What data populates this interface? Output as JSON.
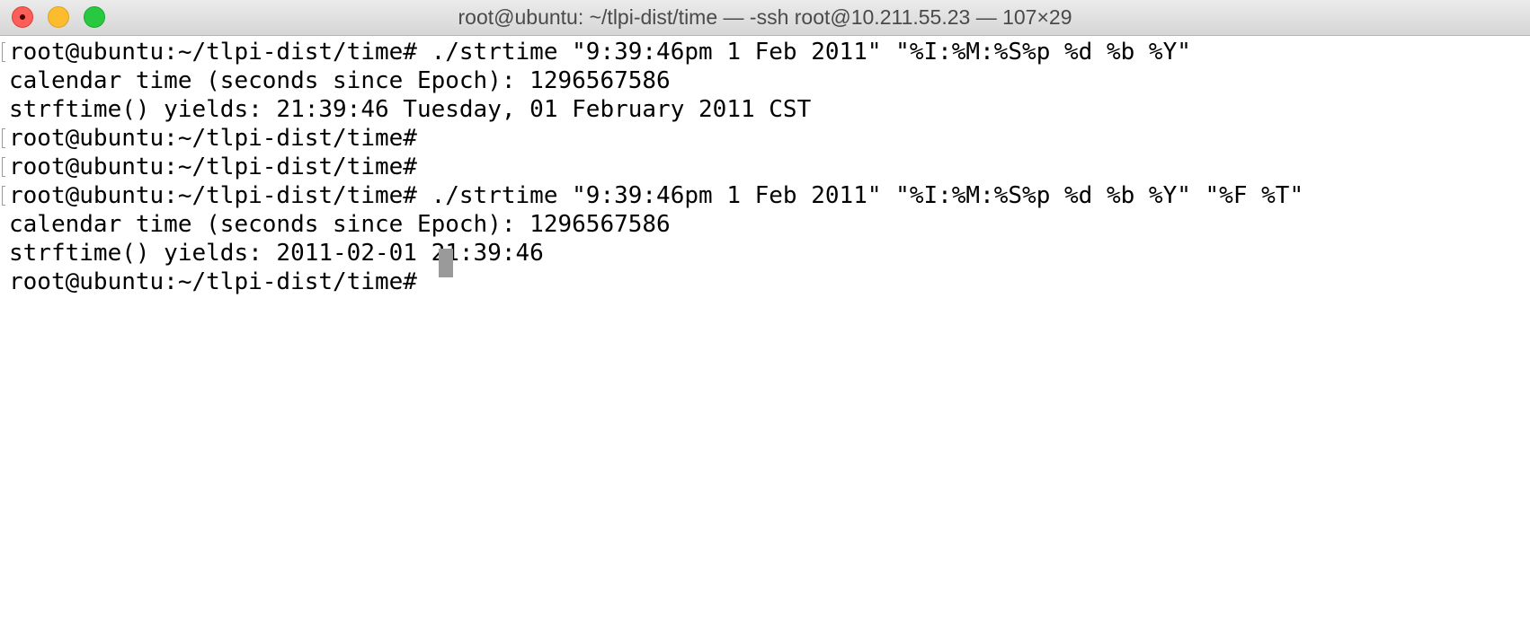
{
  "window": {
    "title": "root@ubuntu: ~/tlpi-dist/time — -ssh root@10.211.55.23 — 107×29",
    "controls": [
      "close-icon",
      "minimize-icon",
      "zoom-icon"
    ],
    "colors": {
      "close": "#fc5f57",
      "minimize": "#fdbc2e",
      "zoom": "#28c840",
      "background": "#ffffff",
      "text": "#000000",
      "cursor": "#9a9a9a"
    }
  },
  "terminal": {
    "lines": [
      "root@ubuntu:~/tlpi-dist/time# ./strtime \"9:39:46pm 1 Feb 2011\" \"%I:%M:%S%p %d %b %Y\"",
      "calendar time (seconds since Epoch): 1296567586",
      "strftime() yields: 21:39:46 Tuesday, 01 February 2011 CST",
      "root@ubuntu:~/tlpi-dist/time#",
      "root@ubuntu:~/tlpi-dist/time#",
      "root@ubuntu:~/tlpi-dist/time# ./strtime \"9:39:46pm 1 Feb 2011\" \"%I:%M:%S%p %d %b %Y\" \"%F %T\"",
      "calendar time (seconds since Epoch): 1296567586",
      "strftime() yields: 2011-02-01 21:39:46",
      "root@ubuntu:~/tlpi-dist/time# "
    ]
  }
}
